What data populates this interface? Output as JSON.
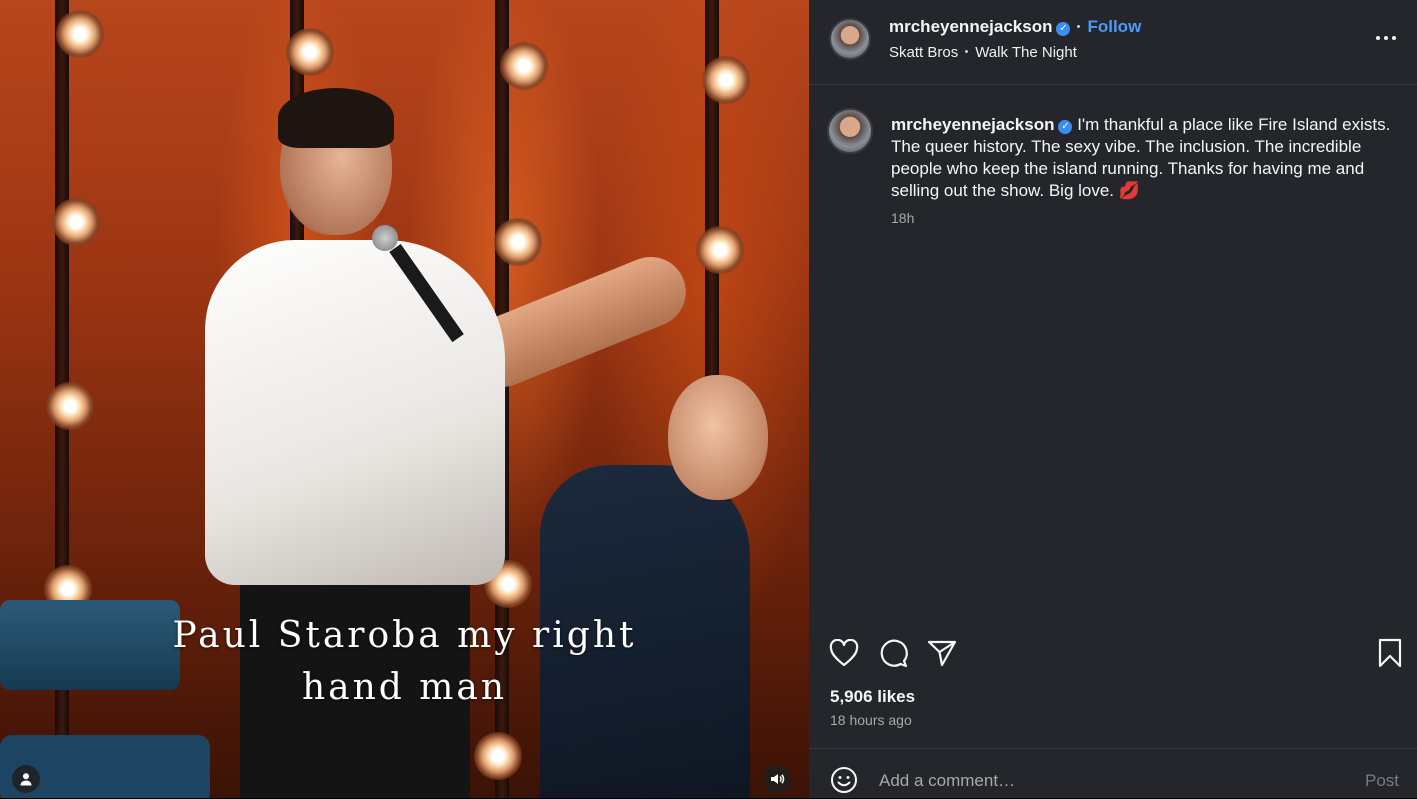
{
  "media": {
    "caption_line1": "Paul Staroba my right",
    "caption_line2": "hand man",
    "user_icon": "person-icon",
    "sound_icon": "speaker-icon"
  },
  "header": {
    "username": "mrcheyennejackson",
    "verified_icon": "verified-badge-icon",
    "follow_label": "Follow",
    "audio_artist": "Skatt Bros",
    "audio_track": "Walk The Night",
    "more_icon": "more-options-icon"
  },
  "post": {
    "username": "mrcheyennejackson",
    "caption": "I'm thankful a place like Fire Island exists. The queer history. The sexy vibe. The inclusion. The incredible people who keep the island running. Thanks for having me and selling out the show. Big love. 💋",
    "time": "18h"
  },
  "actions": {
    "like_icon": "heart-icon",
    "comment_icon": "comment-icon",
    "share_icon": "send-icon",
    "save_icon": "bookmark-icon",
    "likes": "5,906 likes",
    "posted": "18 hours ago"
  },
  "comment_box": {
    "emoji_icon": "emoji-icon",
    "placeholder": "Add a comment…",
    "post_label": "Post"
  },
  "colors": {
    "panel_bg": "#25262b",
    "accent_blue": "#4d9bf5",
    "verified_blue": "#3a8df5"
  }
}
